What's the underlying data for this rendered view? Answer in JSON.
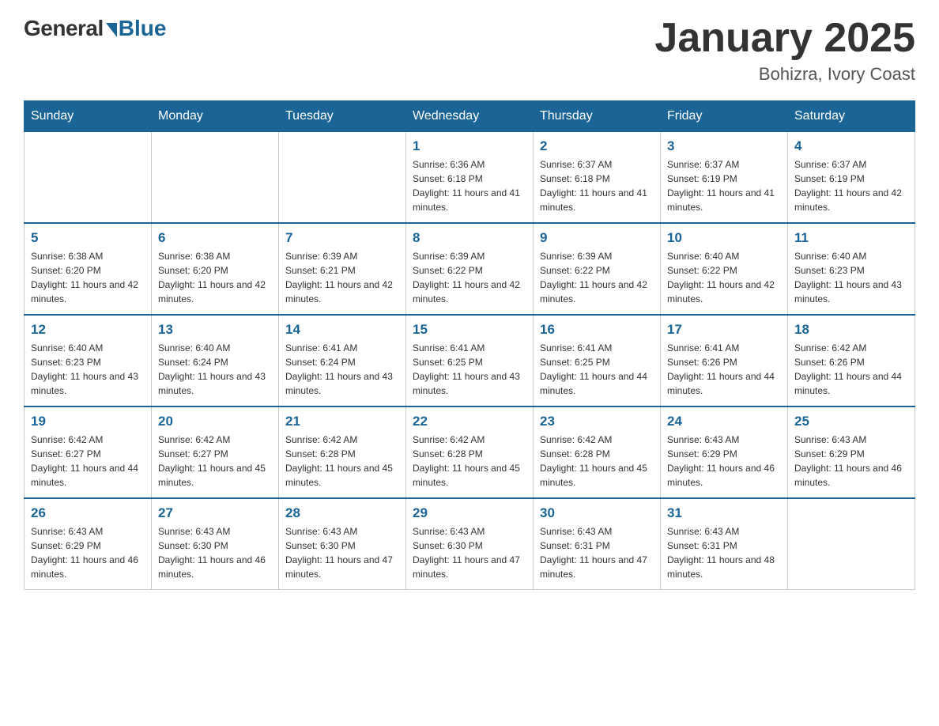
{
  "header": {
    "logo": {
      "general": "General",
      "blue": "Blue"
    },
    "title": "January 2025",
    "location": "Bohizra, Ivory Coast"
  },
  "weekdays": [
    "Sunday",
    "Monday",
    "Tuesday",
    "Wednesday",
    "Thursday",
    "Friday",
    "Saturday"
  ],
  "weeks": [
    [
      {
        "day": "",
        "sunrise": "",
        "sunset": "",
        "daylight": ""
      },
      {
        "day": "",
        "sunrise": "",
        "sunset": "",
        "daylight": ""
      },
      {
        "day": "",
        "sunrise": "",
        "sunset": "",
        "daylight": ""
      },
      {
        "day": "1",
        "sunrise": "Sunrise: 6:36 AM",
        "sunset": "Sunset: 6:18 PM",
        "daylight": "Daylight: 11 hours and 41 minutes."
      },
      {
        "day": "2",
        "sunrise": "Sunrise: 6:37 AM",
        "sunset": "Sunset: 6:18 PM",
        "daylight": "Daylight: 11 hours and 41 minutes."
      },
      {
        "day": "3",
        "sunrise": "Sunrise: 6:37 AM",
        "sunset": "Sunset: 6:19 PM",
        "daylight": "Daylight: 11 hours and 41 minutes."
      },
      {
        "day": "4",
        "sunrise": "Sunrise: 6:37 AM",
        "sunset": "Sunset: 6:19 PM",
        "daylight": "Daylight: 11 hours and 42 minutes."
      }
    ],
    [
      {
        "day": "5",
        "sunrise": "Sunrise: 6:38 AM",
        "sunset": "Sunset: 6:20 PM",
        "daylight": "Daylight: 11 hours and 42 minutes."
      },
      {
        "day": "6",
        "sunrise": "Sunrise: 6:38 AM",
        "sunset": "Sunset: 6:20 PM",
        "daylight": "Daylight: 11 hours and 42 minutes."
      },
      {
        "day": "7",
        "sunrise": "Sunrise: 6:39 AM",
        "sunset": "Sunset: 6:21 PM",
        "daylight": "Daylight: 11 hours and 42 minutes."
      },
      {
        "day": "8",
        "sunrise": "Sunrise: 6:39 AM",
        "sunset": "Sunset: 6:22 PM",
        "daylight": "Daylight: 11 hours and 42 minutes."
      },
      {
        "day": "9",
        "sunrise": "Sunrise: 6:39 AM",
        "sunset": "Sunset: 6:22 PM",
        "daylight": "Daylight: 11 hours and 42 minutes."
      },
      {
        "day": "10",
        "sunrise": "Sunrise: 6:40 AM",
        "sunset": "Sunset: 6:22 PM",
        "daylight": "Daylight: 11 hours and 42 minutes."
      },
      {
        "day": "11",
        "sunrise": "Sunrise: 6:40 AM",
        "sunset": "Sunset: 6:23 PM",
        "daylight": "Daylight: 11 hours and 43 minutes."
      }
    ],
    [
      {
        "day": "12",
        "sunrise": "Sunrise: 6:40 AM",
        "sunset": "Sunset: 6:23 PM",
        "daylight": "Daylight: 11 hours and 43 minutes."
      },
      {
        "day": "13",
        "sunrise": "Sunrise: 6:40 AM",
        "sunset": "Sunset: 6:24 PM",
        "daylight": "Daylight: 11 hours and 43 minutes."
      },
      {
        "day": "14",
        "sunrise": "Sunrise: 6:41 AM",
        "sunset": "Sunset: 6:24 PM",
        "daylight": "Daylight: 11 hours and 43 minutes."
      },
      {
        "day": "15",
        "sunrise": "Sunrise: 6:41 AM",
        "sunset": "Sunset: 6:25 PM",
        "daylight": "Daylight: 11 hours and 43 minutes."
      },
      {
        "day": "16",
        "sunrise": "Sunrise: 6:41 AM",
        "sunset": "Sunset: 6:25 PM",
        "daylight": "Daylight: 11 hours and 44 minutes."
      },
      {
        "day": "17",
        "sunrise": "Sunrise: 6:41 AM",
        "sunset": "Sunset: 6:26 PM",
        "daylight": "Daylight: 11 hours and 44 minutes."
      },
      {
        "day": "18",
        "sunrise": "Sunrise: 6:42 AM",
        "sunset": "Sunset: 6:26 PM",
        "daylight": "Daylight: 11 hours and 44 minutes."
      }
    ],
    [
      {
        "day": "19",
        "sunrise": "Sunrise: 6:42 AM",
        "sunset": "Sunset: 6:27 PM",
        "daylight": "Daylight: 11 hours and 44 minutes."
      },
      {
        "day": "20",
        "sunrise": "Sunrise: 6:42 AM",
        "sunset": "Sunset: 6:27 PM",
        "daylight": "Daylight: 11 hours and 45 minutes."
      },
      {
        "day": "21",
        "sunrise": "Sunrise: 6:42 AM",
        "sunset": "Sunset: 6:28 PM",
        "daylight": "Daylight: 11 hours and 45 minutes."
      },
      {
        "day": "22",
        "sunrise": "Sunrise: 6:42 AM",
        "sunset": "Sunset: 6:28 PM",
        "daylight": "Daylight: 11 hours and 45 minutes."
      },
      {
        "day": "23",
        "sunrise": "Sunrise: 6:42 AM",
        "sunset": "Sunset: 6:28 PM",
        "daylight": "Daylight: 11 hours and 45 minutes."
      },
      {
        "day": "24",
        "sunrise": "Sunrise: 6:43 AM",
        "sunset": "Sunset: 6:29 PM",
        "daylight": "Daylight: 11 hours and 46 minutes."
      },
      {
        "day": "25",
        "sunrise": "Sunrise: 6:43 AM",
        "sunset": "Sunset: 6:29 PM",
        "daylight": "Daylight: 11 hours and 46 minutes."
      }
    ],
    [
      {
        "day": "26",
        "sunrise": "Sunrise: 6:43 AM",
        "sunset": "Sunset: 6:29 PM",
        "daylight": "Daylight: 11 hours and 46 minutes."
      },
      {
        "day": "27",
        "sunrise": "Sunrise: 6:43 AM",
        "sunset": "Sunset: 6:30 PM",
        "daylight": "Daylight: 11 hours and 46 minutes."
      },
      {
        "day": "28",
        "sunrise": "Sunrise: 6:43 AM",
        "sunset": "Sunset: 6:30 PM",
        "daylight": "Daylight: 11 hours and 47 minutes."
      },
      {
        "day": "29",
        "sunrise": "Sunrise: 6:43 AM",
        "sunset": "Sunset: 6:30 PM",
        "daylight": "Daylight: 11 hours and 47 minutes."
      },
      {
        "day": "30",
        "sunrise": "Sunrise: 6:43 AM",
        "sunset": "Sunset: 6:31 PM",
        "daylight": "Daylight: 11 hours and 47 minutes."
      },
      {
        "day": "31",
        "sunrise": "Sunrise: 6:43 AM",
        "sunset": "Sunset: 6:31 PM",
        "daylight": "Daylight: 11 hours and 48 minutes."
      },
      {
        "day": "",
        "sunrise": "",
        "sunset": "",
        "daylight": ""
      }
    ]
  ]
}
